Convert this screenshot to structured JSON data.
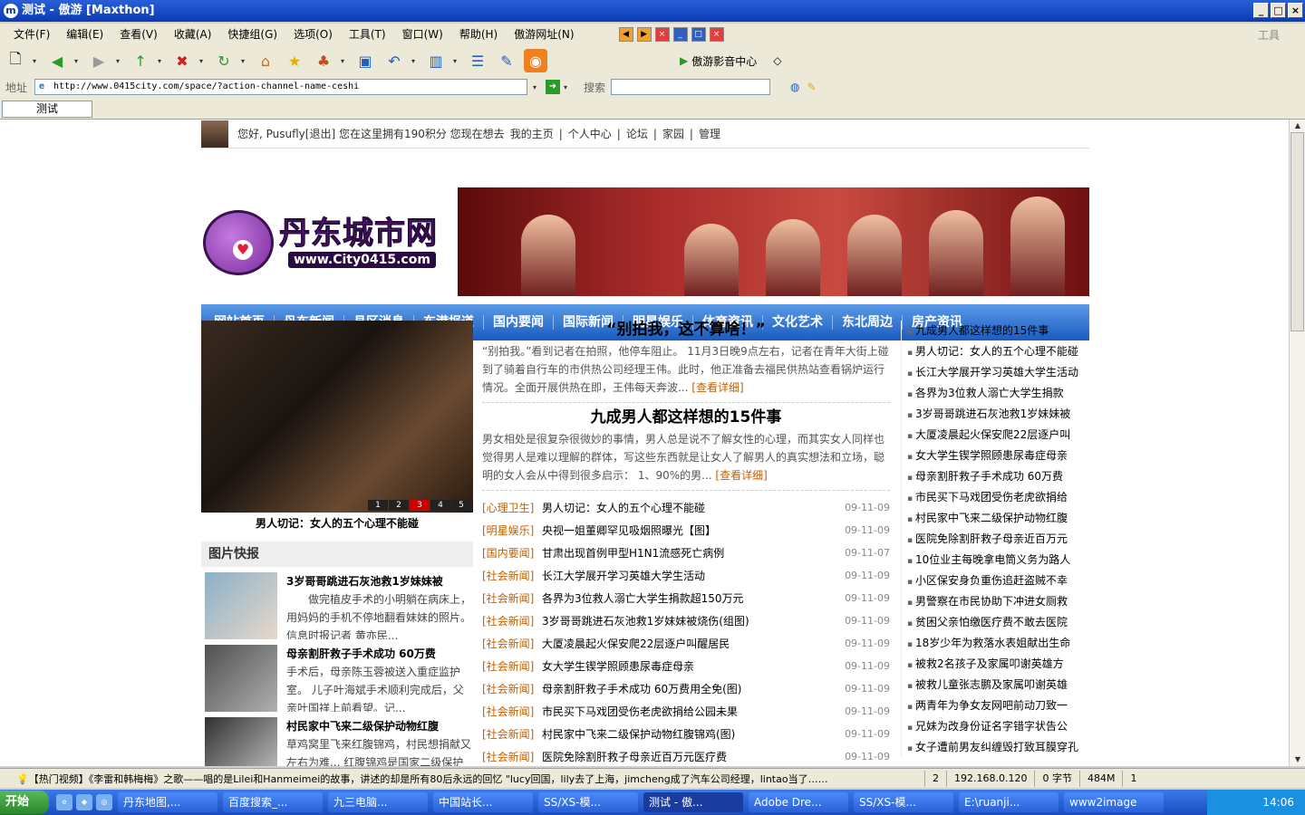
{
  "window": {
    "title": "测试 - 傲游 [Maxthon]",
    "app_icon": "m"
  },
  "menu": [
    "文件(F)",
    "编辑(E)",
    "查看(V)",
    "收藏(A)",
    "快捷组(G)",
    "选项(O)",
    "工具(T)",
    "窗口(W)",
    "帮助(H)",
    "傲游网址(N)"
  ],
  "menu_tools_label": "工具",
  "toolbar": {
    "media_label": "傲游影音中心"
  },
  "address": {
    "label": "地址",
    "url": "http://www.0415city.com/space/?action-channel-name-ceshi",
    "search_label": "搜索",
    "search_value": ""
  },
  "tab": {
    "label": "测试"
  },
  "site": {
    "userbar": {
      "greeting": "您好, Pusufly[退出] 您在这里拥有190积分 您现在想去",
      "links": [
        "我的主页",
        "个人中心",
        "论坛",
        "家园",
        "管理"
      ]
    },
    "logo": {
      "name": "丹东城市网",
      "url": "www.City0415.com"
    },
    "nav": [
      "网站首页",
      "丹东新闻",
      "县区消息",
      "东港报道",
      "国内要闻",
      "国际新闻",
      "明星娱乐",
      "体育资讯",
      "文化艺术",
      "东北周边",
      "房产资讯"
    ],
    "slider": {
      "caption": "男人切记：女人的五个心理不能碰",
      "pages": [
        "1",
        "2",
        "3",
        "4",
        "5"
      ],
      "active": "3"
    },
    "pic_news": {
      "title": "图片快报",
      "items": [
        {
          "title": "3岁哥哥跳进石灰池救1岁妹妹被",
          "text": "做完植皮手术的小明躺在病床上，用妈妈的手机不停地翻看妹妹的照片。信息时报记者 黄亦民..."
        },
        {
          "title": "母亲割肝救子手术成功 60万费",
          "text": "手术后，母亲陈玉蓉被送入重症监护室。 儿子叶海斌手术顺利完成后，父亲叶国祥上前看望。记..."
        },
        {
          "title": "村民家中飞来二级保护动物红腹",
          "text": "草鸡窝里飞来红腹锦鸡，村民想捐献又左右为难... 红腹锦鸡是国家二级保护"
        }
      ]
    },
    "headlines": [
      {
        "title": "“别拍我，这不算啥！”",
        "summary": "“别拍我。”看到记者在拍照，他停车阻止。 11月3日晚9点左右，记者在青年大街上碰到了骑着自行车的市供热公司经理王伟。此时，他正准备去福民供热站查看锅炉运行情况。全面开展供热在即，王伟每天奔波...",
        "more": "[查看详细]"
      },
      {
        "title": "九成男人都这样想的15件事",
        "summary": "男女相处是很复杂很微妙的事情，男人总是说不了解女性的心理，而其实女人同样也觉得男人是难以理解的群体，写这些东西就是让女人了解男人的真实想法和立场，聪明的女人会从中得到很多启示： 1、90%的男...",
        "more": "[查看详细]"
      }
    ],
    "news": [
      {
        "cat": "[心理卫生]",
        "title": "男人切记：女人的五个心理不能碰",
        "date": "09-11-09"
      },
      {
        "cat": "[明星娱乐]",
        "title": "央视一姐董卿罕见吸烟照曝光【图】",
        "date": "09-11-09"
      },
      {
        "cat": "[国内要闻]",
        "title": "甘肃出现首例甲型H1N1流感死亡病例",
        "date": "09-11-07"
      },
      {
        "cat": "[社会新闻]",
        "title": "长江大学展开学习英雄大学生活动",
        "date": "09-11-09"
      },
      {
        "cat": "[社会新闻]",
        "title": "各界为3位救人溺亡大学生捐款超150万元",
        "date": "09-11-09"
      },
      {
        "cat": "[社会新闻]",
        "title": "3岁哥哥跳进石灰池救1岁妹妹被烧伤(组图)",
        "date": "09-11-09"
      },
      {
        "cat": "[社会新闻]",
        "title": "大厦凌晨起火保安爬22层逐户叫醒居民",
        "date": "09-11-09"
      },
      {
        "cat": "[社会新闻]",
        "title": "女大学生锲学照顾患尿毒症母亲",
        "date": "09-11-09"
      },
      {
        "cat": "[社会新闻]",
        "title": "母亲割肝救子手术成功 60万费用全免(图)",
        "date": "09-11-09"
      },
      {
        "cat": "[社会新闻]",
        "title": "市民买下马戏团受伤老虎欲捐给公园未果",
        "date": "09-11-09"
      },
      {
        "cat": "[社会新闻]",
        "title": "村民家中飞来二级保护动物红腹锦鸡(图)",
        "date": "09-11-09"
      },
      {
        "cat": "[社会新闻]",
        "title": "医院免除割肝救子母亲近百万元医疗费",
        "date": "09-11-09"
      }
    ],
    "side_list": [
      "九成男人都这样想的15件事",
      "男人切记：女人的五个心理不能碰",
      "长江大学展开学习英雄大学生活动",
      "各界为3位救人溺亡大学生捐款",
      "3岁哥哥跳进石灰池救1岁妹妹被",
      "大厦凌晨起火保安爬22层逐户叫",
      "女大学生锲学照顾患尿毒症母亲",
      "母亲割肝救子手术成功 60万费",
      "市民买下马戏团受伤老虎欲捐给",
      "村民家中飞来二级保护动物红腹",
      "医院免除割肝救子母亲近百万元",
      "10位业主每晚拿电筒义务为路人",
      "小区保安身负重伤追赶盗贼不幸",
      "男警察在市民协助下冲进女厕救",
      "贫困父亲怕缴医疗费不敢去医院",
      "18岁少年为救落水表姐献出生命",
      "被救2名孩子及家属叩谢英雄方",
      "被救儿童张志鹏及家属叩谢英雄",
      "两青年为争女友网吧前动刀致一",
      "兄妹为改身份证名字错字状告公",
      "女子遭前男友纠缠毁打致耳膜穿孔"
    ]
  },
  "status": {
    "message": "【热门视频】《李雷和韩梅梅》之歌——唱的是Lilei和Hanmeimei的故事，讲述的却是所有80后永远的回忆 \"lucy回国，lily去了上海，jimcheng成了汽车公司经理，lintao当了……",
    "tabs_count": "2",
    "ip": "192.168.0.120",
    "bytes": "0 字节",
    "mem": "484M",
    "num": "1"
  },
  "taskbar": {
    "start": "开始",
    "tasks": [
      "丹东地图,...",
      "百度搜索_...",
      "九三电脑...",
      "中国站长...",
      "SS/XS-模...",
      "测试 - 傲...",
      "Adobe Dre...",
      "SS/XS-模...",
      "E:\\ruanji...",
      "www2image"
    ],
    "active": 5,
    "time": "14:06"
  }
}
